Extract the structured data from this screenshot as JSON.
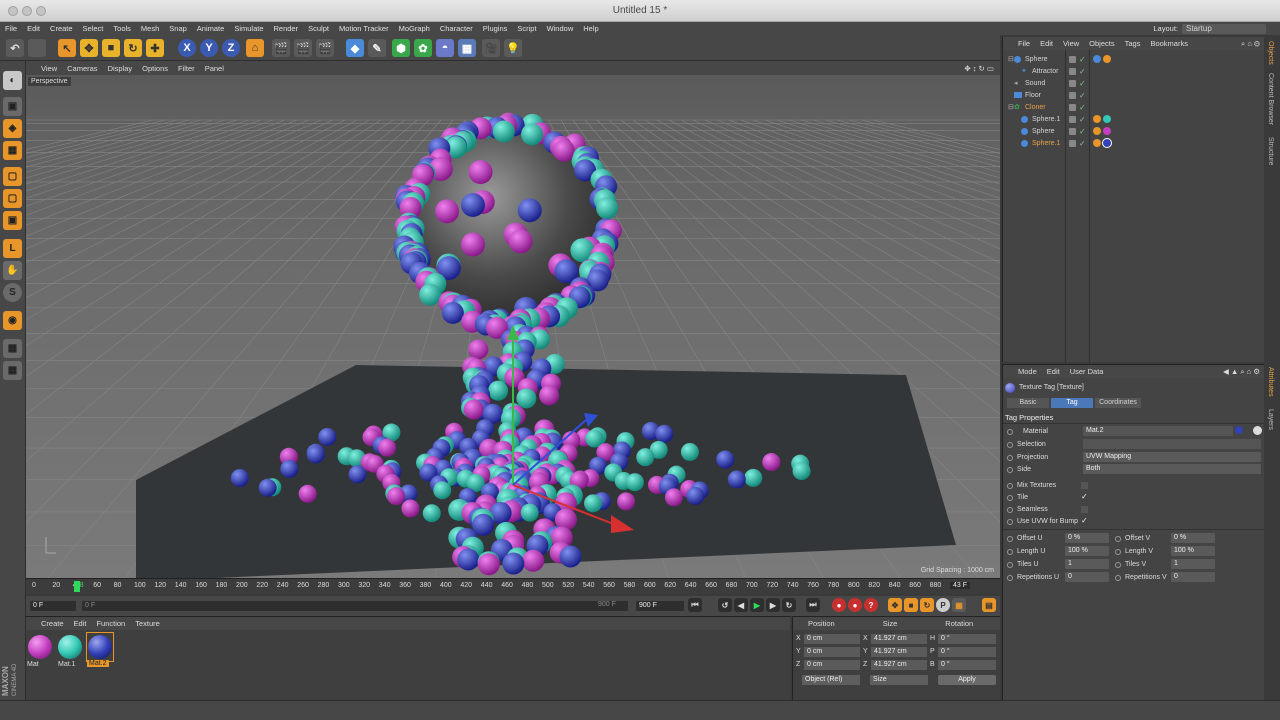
{
  "window": {
    "title": "Untitled 15 *"
  },
  "menubar": {
    "items": [
      "File",
      "Edit",
      "Create",
      "Select",
      "Tools",
      "Mesh",
      "Snap",
      "Animate",
      "Simulate",
      "Render",
      "Sculpt",
      "Motion Tracker",
      "MoGraph",
      "Character",
      "Plugins",
      "Script",
      "Window",
      "Help"
    ],
    "layout_label": "Layout:",
    "layout_value": "Startup"
  },
  "toolbar": {
    "axis_x": "X",
    "axis_y": "Y",
    "axis_z": "Z"
  },
  "viewport": {
    "menu": [
      "View",
      "Cameras",
      "Display",
      "Options",
      "Filter",
      "Panel"
    ],
    "view_name": "Perspective",
    "grid_spacing": "Grid Spacing : 1000 cm"
  },
  "timeline": {
    "ticks": [
      "0",
      "20",
      "40",
      "43",
      "60",
      "80",
      "100",
      "120",
      "140",
      "160",
      "180",
      "200",
      "220",
      "240",
      "260",
      "280",
      "300",
      "320",
      "340",
      "360",
      "380",
      "400",
      "420",
      "440",
      "460",
      "480",
      "500",
      "520",
      "540",
      "560",
      "580",
      "600",
      "620",
      "640",
      "660",
      "680",
      "700",
      "720",
      "740",
      "760",
      "780",
      "800",
      "820",
      "840",
      "860",
      "880",
      "900"
    ],
    "current_frame_label": "43 F",
    "start_frame": "0 F",
    "min_frame": "0 F",
    "max_frame": "900 F",
    "end_frame": "900 F"
  },
  "materials": {
    "menu": [
      "Create",
      "Edit",
      "Function",
      "Texture"
    ],
    "items": [
      {
        "name": "Mat",
        "color": "#c43ec0"
      },
      {
        "name": "Mat.1",
        "color": "#33c7b5"
      },
      {
        "name": "Mat.2",
        "color": "#3340b8"
      }
    ]
  },
  "coordinates": {
    "headers": [
      "Position",
      "Size",
      "Rotation"
    ],
    "rows": [
      {
        "axis": "X",
        "pos": "0 cm",
        "size_axis": "X",
        "size": "41.927 cm",
        "rot_axis": "H",
        "rot": "0 °"
      },
      {
        "axis": "Y",
        "pos": "0 cm",
        "size_axis": "Y",
        "size": "41.927 cm",
        "rot_axis": "P",
        "rot": "0 °"
      },
      {
        "axis": "Z",
        "pos": "0 cm",
        "size_axis": "Z",
        "size": "41.927 cm",
        "rot_axis": "B",
        "rot": "0 °"
      }
    ],
    "mode": "Object (Rel)",
    "size_mode": "Size",
    "apply_label": "Apply"
  },
  "object_manager": {
    "menu": [
      "File",
      "Edit",
      "View",
      "Objects",
      "Tags",
      "Bookmarks"
    ],
    "objects": [
      {
        "name": "Sphere",
        "color": "#d8d8d8"
      },
      {
        "name": "Attractor",
        "color": "#d8d8d8"
      },
      {
        "name": "Sound",
        "color": "#d8d8d8"
      },
      {
        "name": "Floor",
        "color": "#d8d8d8"
      },
      {
        "name": "Cloner",
        "color": "#e8a24a"
      },
      {
        "name": "Sphere.1",
        "color": "#d8d8d8"
      },
      {
        "name": "Sphere",
        "color": "#d8d8d8"
      },
      {
        "name": "Sphere.1",
        "color": "#e8a24a"
      }
    ]
  },
  "attributes": {
    "menu": [
      "Mode",
      "Edit",
      "User Data"
    ],
    "title": "Texture Tag [Texture]",
    "tabs": [
      "Basic",
      "Tag",
      "Coordinates"
    ],
    "section": "Tag Properties",
    "material_label": "Material",
    "material_value": "Mat.2",
    "selection_label": "Selection",
    "projection_label": "Projection",
    "projection_value": "UVW Mapping",
    "side_label": "Side",
    "side_value": "Both",
    "mix_textures_label": "Mix Textures",
    "tile_label": "Tile",
    "seamless_label": "Seamless",
    "use_uvw_label": "Use UVW for Bump",
    "offset_u_label": "Offset U",
    "offset_u_value": "0 %",
    "offset_v_label": "Offset V",
    "offset_v_value": "0 %",
    "length_u_label": "Length U",
    "length_u_value": "100 %",
    "length_v_label": "Length V",
    "length_v_value": "100 %",
    "tiles_u_label": "Tiles U",
    "tiles_u_value": "1",
    "tiles_v_label": "Tiles V",
    "tiles_v_value": "1",
    "rep_u_label": "Repetitions U",
    "rep_u_value": "0",
    "rep_v_label": "Repetitions V",
    "rep_v_value": "0"
  },
  "sidetabs": [
    "Objects",
    "Content Browser",
    "Structure",
    "Attributes",
    "Layers"
  ],
  "brand": {
    "maxon": "MAXON",
    "cinema": "CINEMA 4D"
  }
}
